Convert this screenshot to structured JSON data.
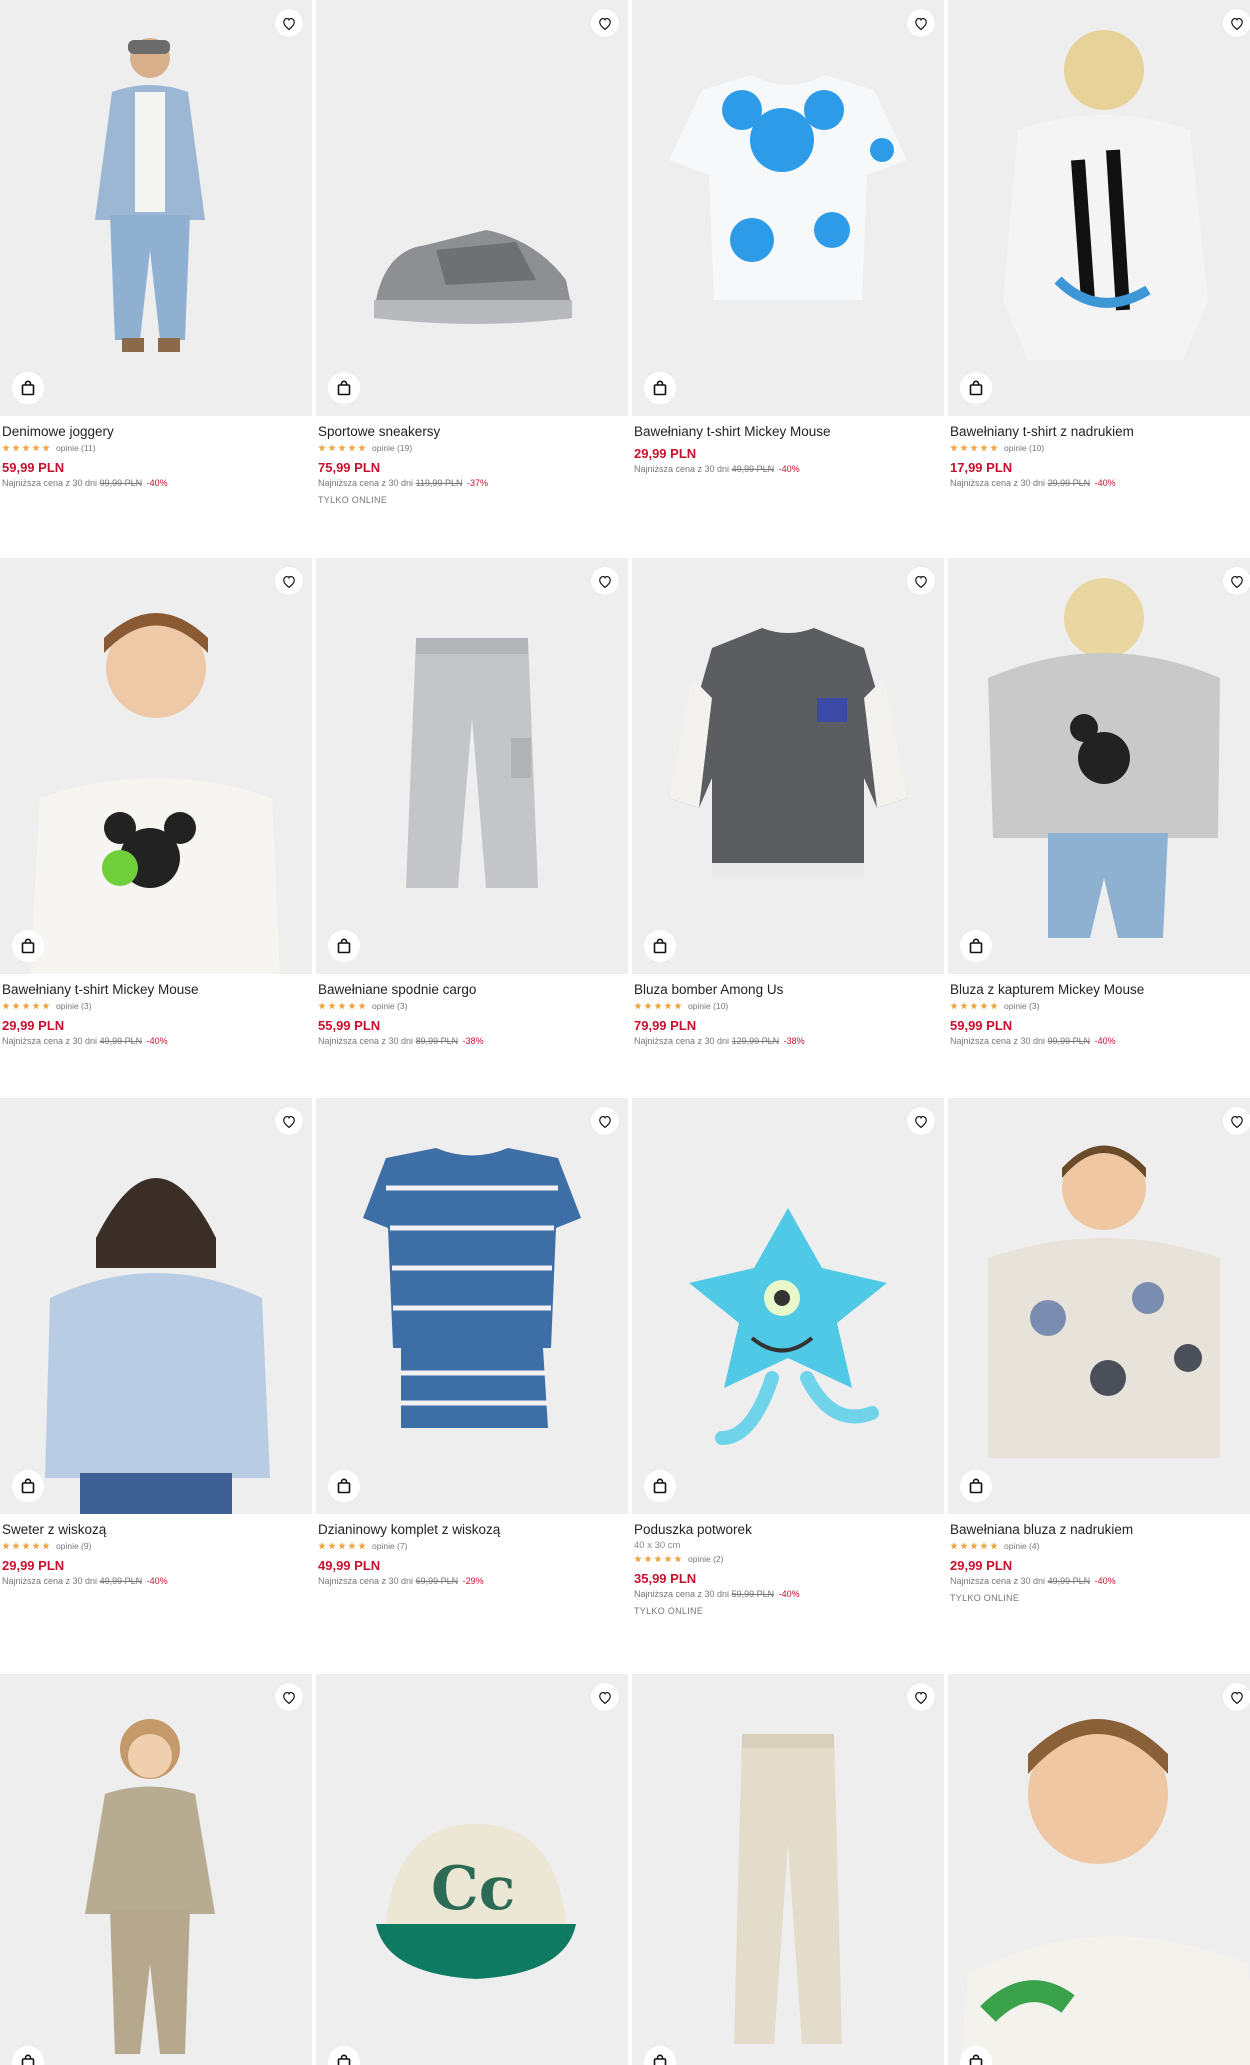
{
  "icons": {
    "favorite": "heart-icon",
    "bag": "shopping-bag-icon"
  },
  "colors": {
    "price": "#c8102e",
    "star": "#f0a23a",
    "image_bg": "#eeeeef"
  },
  "products": [
    {
      "name": "Denimowe joggery",
      "reviews": "opinie (11)",
      "price": "59,99 PLN",
      "lowest_label": "Najniższa cena z 30 dni",
      "old_price": "99,99 PLN",
      "discount": "-40%"
    },
    {
      "name": "Sportowe sneakersy",
      "reviews": "opinie (19)",
      "price": "75,99 PLN",
      "lowest_label": "Najniższa cena z 30 dni",
      "old_price": "119,99 PLN",
      "discount": "-37%",
      "tag": "TYLKO ONLINE"
    },
    {
      "name": "Bawełniany t-shirt Mickey Mouse",
      "price": "29,99 PLN",
      "lowest_label": "Najniższa cena z 30 dni",
      "old_price": "49,99 PLN",
      "discount": "-40%"
    },
    {
      "name": "Bawełniany t-shirt z nadrukiem",
      "reviews": "opinie (10)",
      "price": "17,99 PLN",
      "lowest_label": "Najniższa cena z 30 dni",
      "old_price": "29,99 PLN",
      "discount": "-40%"
    },
    {
      "name": "Bawełniany t-shirt Mickey Mouse",
      "reviews": "opinie (3)",
      "price": "29,99 PLN",
      "lowest_label": "Najniższa cena z 30 dni",
      "old_price": "49,99 PLN",
      "discount": "-40%"
    },
    {
      "name": "Bawełniane spodnie cargo",
      "reviews": "opinie (3)",
      "price": "55,99 PLN",
      "lowest_label": "Najniższa cena z 30 dni",
      "old_price": "89,99 PLN",
      "discount": "-38%"
    },
    {
      "name": "Bluza bomber Among Us",
      "reviews": "opinie (10)",
      "price": "79,99 PLN",
      "lowest_label": "Najniższa cena z 30 dni",
      "old_price": "129,99 PLN",
      "discount": "-38%"
    },
    {
      "name": "Bluza z kapturem Mickey Mouse",
      "reviews": "opinie (3)",
      "price": "59,99 PLN",
      "lowest_label": "Najniższa cena z 30 dni",
      "old_price": "99,99 PLN",
      "discount": "-40%"
    },
    {
      "name": "Sweter z wiskozą",
      "reviews": "opinie (9)",
      "price": "29,99 PLN",
      "lowest_label": "Najniższa cena z 30 dni",
      "old_price": "49,99 PLN",
      "discount": "-40%"
    },
    {
      "name": "Dzianinowy komplet z wiskozą",
      "reviews": "opinie (7)",
      "price": "49,99 PLN",
      "lowest_label": "Najniższa cena z 30 dni",
      "old_price": "69,99 PLN",
      "discount": "-29%"
    },
    {
      "name": "Poduszka potworek",
      "size": "40 x 30 cm",
      "reviews": "opinie (2)",
      "price": "35,99 PLN",
      "lowest_label": "Najniższa cena z 30 dni",
      "old_price": "59,99 PLN",
      "discount": "-40%",
      "tag": "TYLKO ONLINE"
    },
    {
      "name": "Bawełniana bluza z nadrukiem",
      "reviews": "opinie (4)",
      "price": "29,99 PLN",
      "lowest_label": "Najniższa cena z 30 dni",
      "old_price": "49,99 PLN",
      "discount": "-40%",
      "tag": "TYLKO ONLINE"
    },
    {
      "name": ""
    },
    {
      "name": ""
    },
    {
      "name": ""
    },
    {
      "name": ""
    }
  ]
}
